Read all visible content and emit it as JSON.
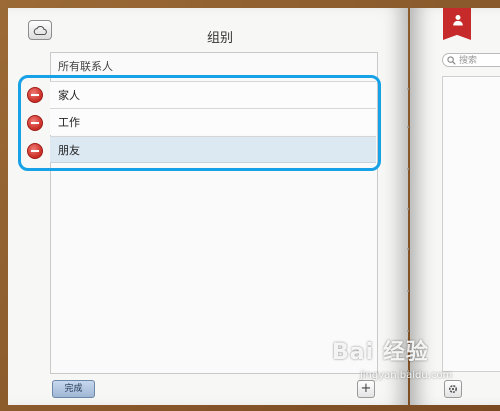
{
  "header": {
    "title": "组别"
  },
  "groups": {
    "all_label": "所有联系人",
    "items": [
      {
        "label": "家人"
      },
      {
        "label": "工作"
      },
      {
        "label": "朋友"
      }
    ]
  },
  "toolbar": {
    "done_label": "完成",
    "add_label": "+"
  },
  "right_panel": {
    "search_placeholder": "搜索"
  },
  "watermark": {
    "main": "Bai 经验",
    "sub": "jingyan.baidu.com"
  },
  "colors": {
    "highlight": "#17a1e6",
    "bookmark": "#c62a2a",
    "delete": "#d83a33"
  },
  "icons": {
    "sync": "cloud-icon",
    "delete": "minus-circle-icon",
    "contact": "person-icon",
    "search": "search-icon",
    "settings": "gear-icon"
  }
}
